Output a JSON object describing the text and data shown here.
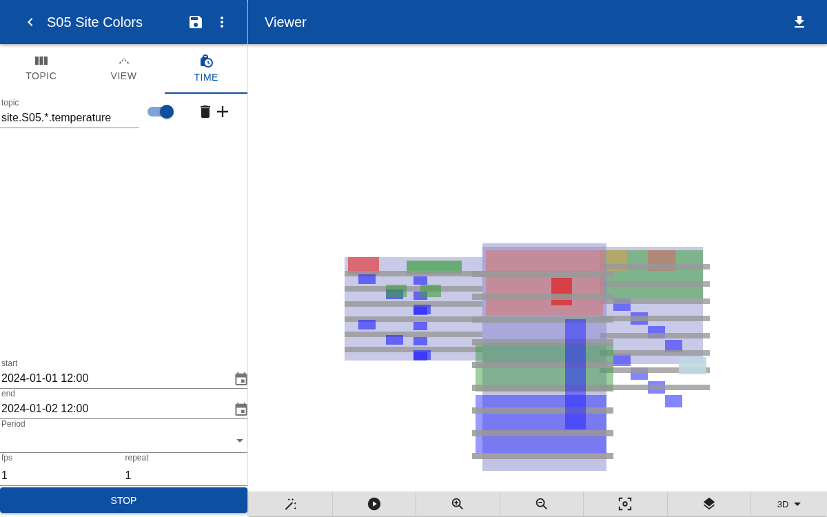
{
  "app_bar": {
    "title": "S05 Site Colors"
  },
  "tabs": [
    {
      "label": "TOPIC",
      "selected": false
    },
    {
      "label": "VIEW",
      "selected": false
    },
    {
      "label": "TIME",
      "selected": true
    }
  ],
  "topic": {
    "label": "topic",
    "value": "site.S05.*.temperature",
    "enabled": true
  },
  "start": {
    "label": "start",
    "value": "2024-01-01 12:00"
  },
  "end": {
    "label": "end",
    "value": "2024-01-02 12:00"
  },
  "period": {
    "label": "Period"
  },
  "fps": {
    "label": "fps",
    "value": "1"
  },
  "repeat": {
    "label": "repeat",
    "value": "1"
  },
  "stop_button": "STOP",
  "viewer": {
    "title": "Viewer",
    "mode": "3D"
  }
}
